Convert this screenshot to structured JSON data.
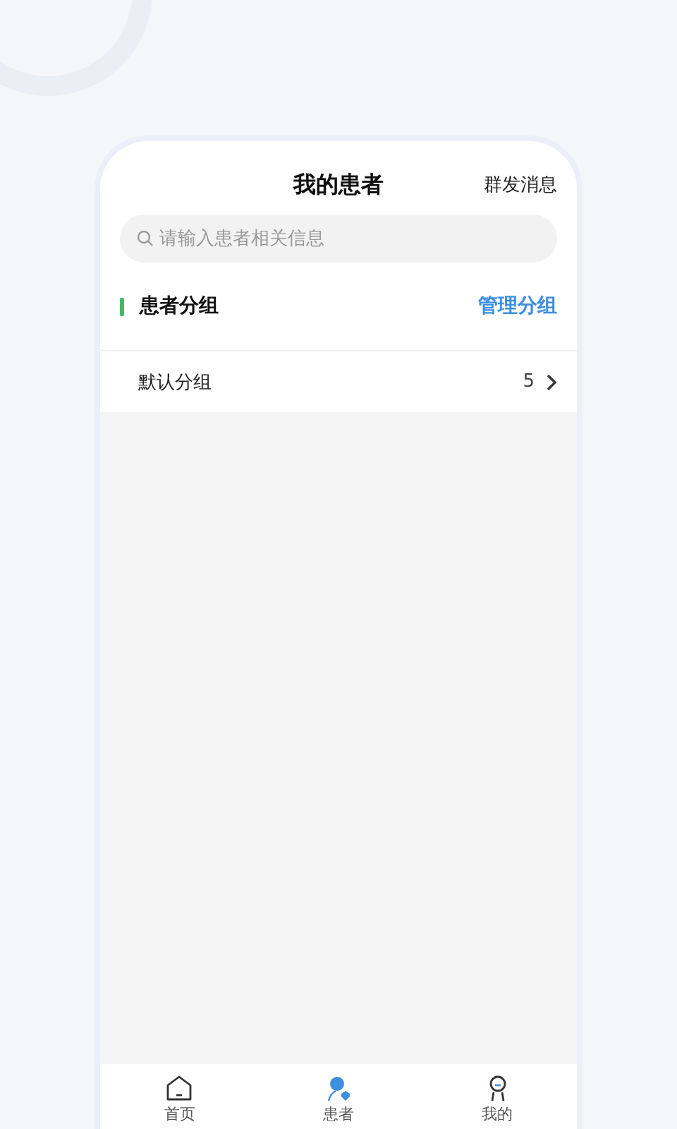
{
  "header": {
    "title": "我的患者",
    "action": "群发消息"
  },
  "search": {
    "placeholder": "请输入患者相关信息"
  },
  "section": {
    "title": "患者分组",
    "action": "管理分组"
  },
  "groups": [
    {
      "name": "默认分组",
      "count": "5"
    }
  ],
  "tabs": [
    {
      "label": "首页",
      "selected": false
    },
    {
      "label": "患者",
      "selected": true
    },
    {
      "label": "我的",
      "selected": false
    }
  ]
}
